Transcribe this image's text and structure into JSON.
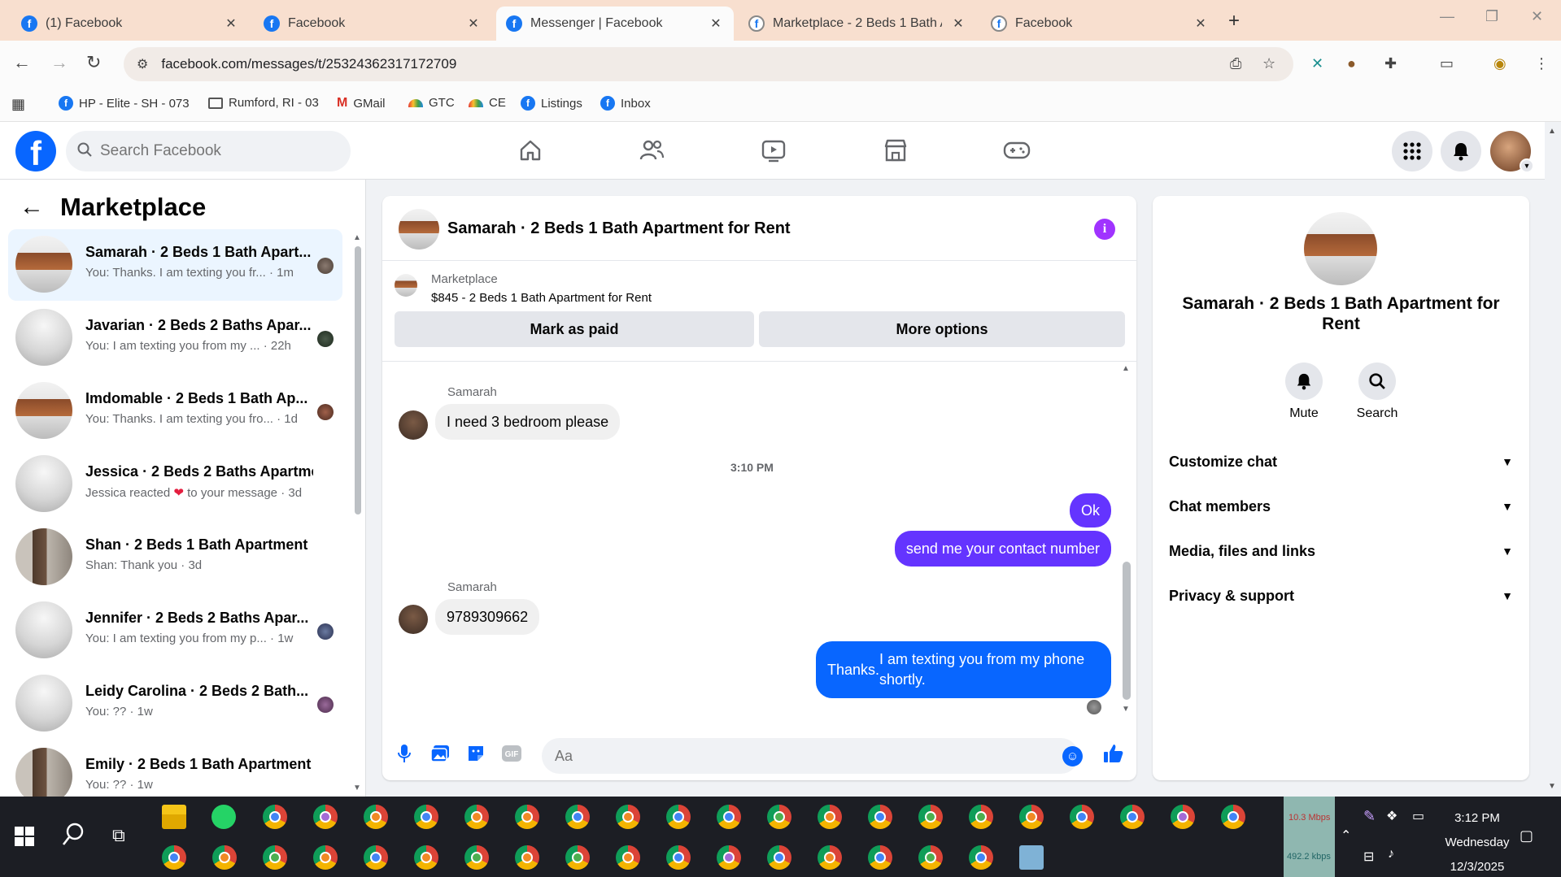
{
  "browser": {
    "tabs": [
      {
        "title": "(1) Facebook",
        "active": false
      },
      {
        "title": "Facebook",
        "active": false
      },
      {
        "title": "Messenger | Facebook",
        "active": true
      },
      {
        "title": "Marketplace - 2 Beds 1 Bath Ap",
        "active": false
      },
      {
        "title": "Facebook",
        "active": false
      }
    ],
    "url": "facebook.com/messages/t/25324362317172709",
    "bookmarks": [
      {
        "label": "HP - Elite - SH - 073",
        "icon": "facebook-icon"
      },
      {
        "label": "Rumford, RI - 03",
        "icon": "folder-icon"
      },
      {
        "label": "GMail",
        "icon": "gmail-icon"
      },
      {
        "label": "GTC",
        "icon": "rainbow-icon"
      },
      {
        "label": "CE",
        "icon": "rainbow-icon"
      },
      {
        "label": "Listings",
        "icon": "facebook-icon"
      },
      {
        "label": "Inbox",
        "icon": "facebook-icon"
      }
    ]
  },
  "fb": {
    "search_placeholder": "Search Facebook",
    "brand_color": "#0866ff"
  },
  "left": {
    "title": "Marketplace",
    "conversations": [
      {
        "title": "Samarah · 2 Beds 1 Bath Apart...",
        "sub": "You: Thanks. I am texting you fr... · 1m",
        "thumb": "kitchen",
        "active": true
      },
      {
        "title": "Javarian · 2 Beds 2 Baths Apar...",
        "sub": "You: I am texting you from my ... · 22h",
        "thumb": "room",
        "active": false
      },
      {
        "title": "Imdomable · 2 Beds 1 Bath Ap...",
        "sub": "You: Thanks. I am texting you fro... · 1d",
        "thumb": "kitchen",
        "active": false
      },
      {
        "title": "Jessica · 2 Beds 2 Baths Apartme...",
        "sub_pre": "Jessica reacted ",
        "sub_post": " to your message · 3d",
        "thumb": "room",
        "active": false
      },
      {
        "title": "Shan · 2 Beds 1 Bath Apartment",
        "sub": "Shan: Thank you · 3d",
        "thumb": "door",
        "active": false
      },
      {
        "title": "Jennifer · 2 Beds 2 Baths Apar...",
        "sub": "You: I am texting you from my p... · 1w",
        "thumb": "room",
        "active": false
      },
      {
        "title": "Leidy Carolina · 2 Beds 2 Bath...",
        "sub": "You: ?? · 1w",
        "thumb": "room",
        "active": false
      },
      {
        "title": "Emily · 2 Beds 1 Bath Apartment",
        "sub": "You: ?? · 1w",
        "thumb": "door",
        "active": false
      }
    ]
  },
  "chat": {
    "title": "Samarah · 2 Beds 1 Bath Apartment for Rent",
    "marketplace_label": "Marketplace",
    "listing": "$845 - 2 Beds 1 Bath Apartment for Rent",
    "mark_paid": "Mark as paid",
    "more_options": "More options",
    "messages": [
      {
        "sender": "Samarah",
        "text": "I need 3 bedroom please"
      },
      {
        "timestamp": "3:10 PM"
      },
      {
        "text": "Ok"
      },
      {
        "text": "send me your contact number"
      },
      {
        "sender": "Samarah",
        "text": "9789309662"
      },
      {
        "text_line1": "Thanks.",
        "text_line2": "I am texting you from my phone shortly."
      }
    ],
    "composer_placeholder": "Aa",
    "colors": {
      "outgoing": "#6434ff",
      "outgoing_latest": "#0866ff",
      "incoming": "#f0f0f0"
    }
  },
  "info": {
    "title": "Samarah · 2 Beds 1 Bath Apartment for Rent",
    "mute": "Mute",
    "search": "Search",
    "sections": [
      "Customize chat",
      "Chat members",
      "Media, files and links",
      "Privacy & support"
    ]
  },
  "taskbar": {
    "net_up": "10.3 Mbps",
    "net_down": "492.2 kbps",
    "time": "3:12 PM",
    "day": "Wednesday",
    "date": "12/3/2025"
  }
}
